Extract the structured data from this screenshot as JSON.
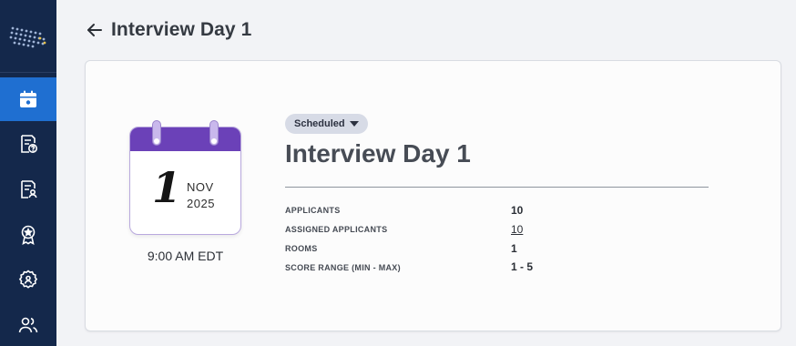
{
  "sidebar": {
    "items": [
      {
        "name": "calendar",
        "active": true
      },
      {
        "name": "review"
      },
      {
        "name": "evaluation"
      },
      {
        "name": "award"
      },
      {
        "name": "settings"
      },
      {
        "name": "users"
      }
    ]
  },
  "header": {
    "title": "Interview Day 1"
  },
  "event": {
    "status": "Scheduled",
    "title": "Interview Day 1",
    "date": {
      "day": "1",
      "month": "NOV",
      "year": "2025"
    },
    "time": "9:00 AM EDT",
    "stats": [
      {
        "label": "APPLICANTS",
        "value": "10"
      },
      {
        "label": "ASSIGNED APPLICANTS",
        "value": "10"
      },
      {
        "label": "ROOMS",
        "value": "1"
      },
      {
        "label": "SCORE RANGE (MIN - MAX)",
        "value": "1 - 5"
      }
    ]
  },
  "colors": {
    "sidebar": "#14284b",
    "accent": "#1f6fd1",
    "calendar_band": "#6b41b8"
  }
}
